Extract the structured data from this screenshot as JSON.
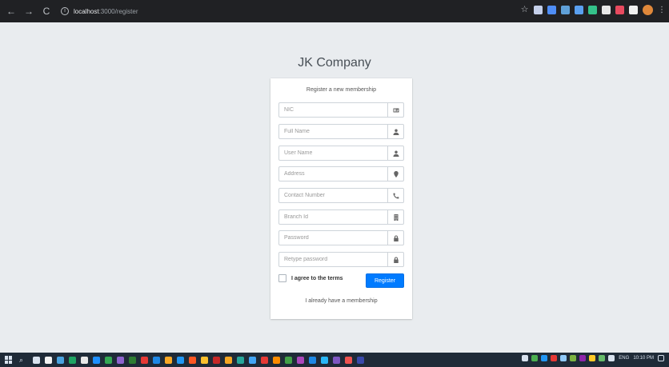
{
  "browser": {
    "url_host": "localhost",
    "url_path": ":3000/register",
    "back_icon": "←",
    "forward_icon": "→",
    "reload_icon": "C",
    "info_icon": "i",
    "star_icon": "☆",
    "menu_icon": "⋮",
    "extension_colors": [
      "#c5d0ea",
      "#4f8ef7",
      "#5fa0d8",
      "#5aa0f0",
      "#34c28a",
      "#e7e7e7",
      "#e84a5f",
      "#f0f0f0"
    ]
  },
  "page": {
    "brand": "JK Company",
    "message": "Register a new membership"
  },
  "fields": {
    "nic": {
      "placeholder": "NIC",
      "icon": "id-card-icon"
    },
    "full_name": {
      "placeholder": "Full Name",
      "icon": "user-icon"
    },
    "user_name": {
      "placeholder": "User Name",
      "icon": "user-icon"
    },
    "address": {
      "placeholder": "Address",
      "icon": "map-marker-icon"
    },
    "contact_number": {
      "placeholder": "Contact Number",
      "icon": "phone-icon"
    },
    "branch_id": {
      "placeholder": "Branch Id",
      "icon": "building-icon"
    },
    "password": {
      "placeholder": "Password",
      "icon": "lock-icon"
    },
    "retype_password": {
      "placeholder": "Retype password",
      "icon": "lock-icon"
    }
  },
  "agree": {
    "label": "I agree to the terms",
    "checked": false
  },
  "register_label": "Register",
  "login_link": "I already have a membership",
  "accent_color": "#007bff",
  "taskbar": {
    "search_icon": "⌕",
    "apps": [
      "#d8e2ee",
      "#f2f2f2",
      "#4aa3df",
      "#1fa463",
      "#e8e8e8",
      "#1e90ff",
      "#34a853",
      "#8e63ce",
      "#2e7d32",
      "#e53935",
      "#1e88e5",
      "#f9a825",
      "#2196f3",
      "#ff5722",
      "#fbc02d",
      "#c62828",
      "#f5a623",
      "#26a69a",
      "#42a5f5",
      "#e53935",
      "#fb8c00",
      "#43a047",
      "#ab47bc",
      "#1e88e5",
      "#29b6f6",
      "#7e57c2",
      "#ef5350",
      "#3949ab"
    ],
    "tray_colors": [
      "#d8e2ee",
      "#4caf50",
      "#2196f3",
      "#e53935",
      "#90caf9",
      "#7cb342",
      "#8e24aa",
      "#ffca28",
      "#66bb6a",
      "#d8e2ee"
    ],
    "language": "ENG",
    "time": "10:10 PM"
  }
}
